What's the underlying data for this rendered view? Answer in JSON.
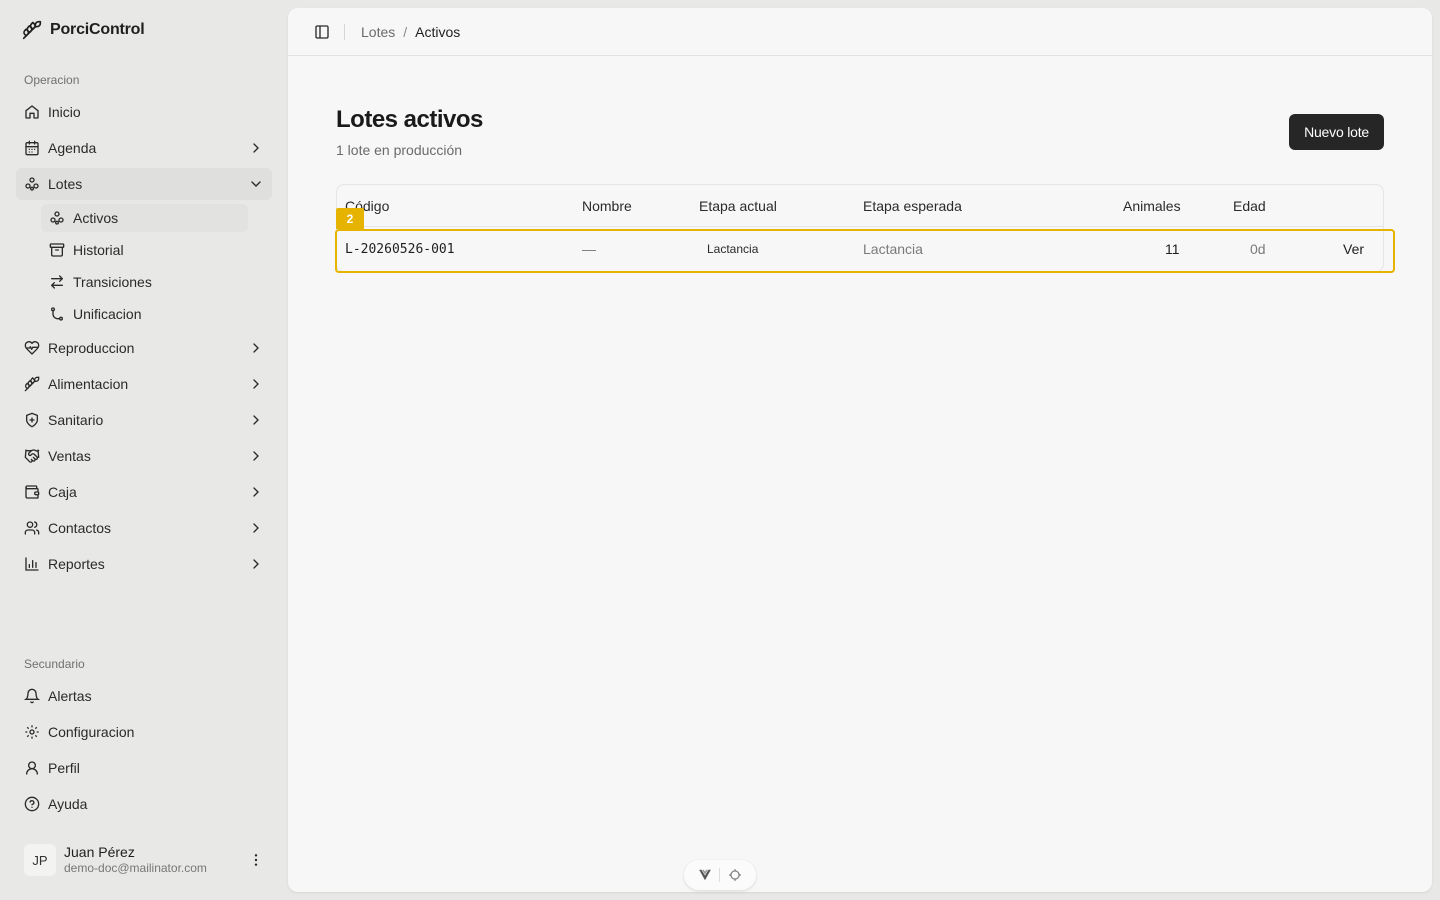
{
  "app": {
    "name": "PorciControl"
  },
  "sidebar": {
    "group_operacion": "Operacion",
    "items": [
      {
        "label": "Inicio",
        "icon": "home-icon"
      },
      {
        "label": "Agenda",
        "icon": "calendar-icon"
      },
      {
        "label": "Lotes",
        "icon": "group-icon"
      },
      {
        "label": "Reproduccion",
        "icon": "heart-pulse-icon"
      },
      {
        "label": "Alimentacion",
        "icon": "wheat-icon"
      },
      {
        "label": "Sanitario",
        "icon": "shield-plus-icon"
      },
      {
        "label": "Ventas",
        "icon": "handshake-icon"
      },
      {
        "label": "Caja",
        "icon": "wallet-icon"
      },
      {
        "label": "Contactos",
        "icon": "users-icon"
      },
      {
        "label": "Reportes",
        "icon": "bar-chart-icon"
      }
    ],
    "lotes_sub": [
      {
        "label": "Activos",
        "icon": "group-icon"
      },
      {
        "label": "Historial",
        "icon": "archive-icon"
      },
      {
        "label": "Transiciones",
        "icon": "arrows-icon"
      },
      {
        "label": "Unificacion",
        "icon": "merge-icon"
      }
    ],
    "group_secundario": "Secundario",
    "secondary": [
      {
        "label": "Alertas",
        "icon": "bell-icon"
      },
      {
        "label": "Configuracion",
        "icon": "gear-icon"
      },
      {
        "label": "Perfil",
        "icon": "user-icon"
      },
      {
        "label": "Ayuda",
        "icon": "help-circle-icon"
      }
    ],
    "user": {
      "initials": "JP",
      "name": "Juan Pérez",
      "email": "demo-doc@mailinator.com"
    }
  },
  "breadcrumb": {
    "parent": "Lotes",
    "separator": "/",
    "current": "Activos"
  },
  "page": {
    "title": "Lotes activos",
    "subtitle": "1 lote en producción",
    "new_button": "Nuevo lote"
  },
  "table": {
    "headers": {
      "codigo": "Código",
      "nombre": "Nombre",
      "etapa_actual": "Etapa actual",
      "etapa_esperada": "Etapa esperada",
      "animales": "Animales",
      "edad": "Edad"
    },
    "rows": [
      {
        "codigo": "L-20260526-001",
        "nombre": "—",
        "etapa_actual": "Lactancia",
        "etapa_esperada": "Lactancia",
        "animales": "11",
        "edad": "0d",
        "action": "Ver"
      }
    ]
  },
  "highlight_tag": "2",
  "colors": {
    "accent": "#262626",
    "highlight": "#e6b400",
    "sidebar_bg": "#e8e8e6",
    "panel_bg": "#f7f7f7"
  }
}
